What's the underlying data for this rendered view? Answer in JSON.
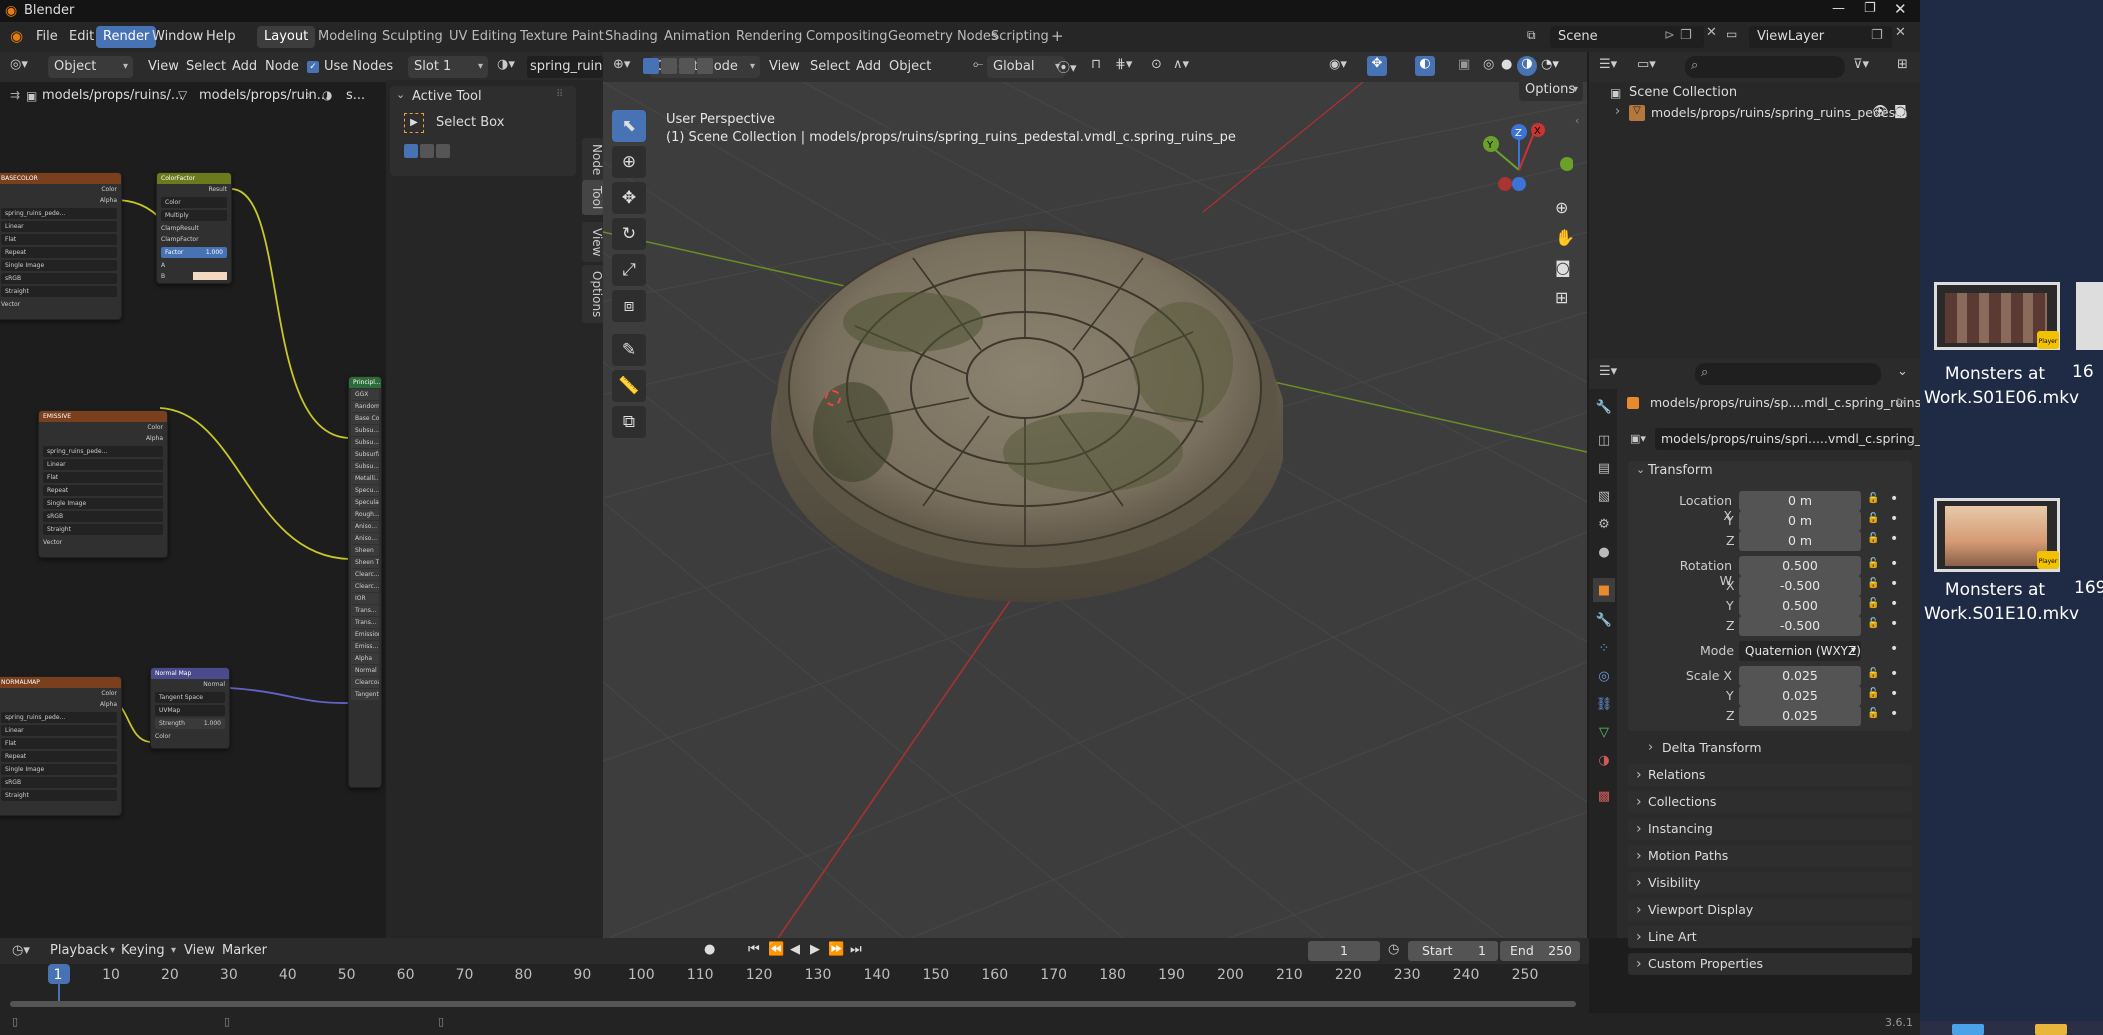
{
  "app": {
    "title": "Blender",
    "version": "3.6.1"
  },
  "menu": [
    "File",
    "Edit",
    "Render",
    "Window",
    "Help"
  ],
  "active_menu": "Render",
  "workspaces": [
    "Layout",
    "Modeling",
    "Sculpting",
    "UV Editing",
    "Texture Paint",
    "Shading",
    "Animation",
    "Rendering",
    "Compositing",
    "Geometry Nodes",
    "Scripting"
  ],
  "active_workspace": "Layout",
  "scene": {
    "name": "Scene",
    "view_layer": "ViewLayer"
  },
  "node_editor": {
    "object_mode": "Object",
    "menus": [
      "View",
      "Select",
      "Add",
      "Node"
    ],
    "use_nodes": "Use Nodes",
    "slot": "Slot 1",
    "material": "spring_ruins_p",
    "breadcrumb": [
      "models/props/ruins/...",
      "models/props/ruin...",
      "s..."
    ],
    "nodes": {
      "basecolor": {
        "title": "BASECOLOR",
        "img": "spring_ruins_pede...",
        "rows": [
          "Linear",
          "Flat",
          "Repeat",
          "Single Image",
          "sRGB",
          "Straight"
        ],
        "outputs": [
          "Color",
          "Alpha"
        ],
        "vector": "Vector"
      },
      "colorfactor": {
        "title": "ColorFactor",
        "out": "Result",
        "rows": [
          "Color",
          "Multiply",
          "ClampResult",
          "ClampFactor"
        ],
        "factor": "Factor",
        "factor_value": "1.000",
        "a": "A",
        "b": "B"
      },
      "emissive": {
        "title": "EMISSIVE",
        "img": "spring_ruins_pede...",
        "rows": [
          "Linear",
          "Flat",
          "Repeat",
          "Single Image",
          "sRGB",
          "Straight"
        ],
        "outputs": [
          "Color",
          "Alpha"
        ],
        "vector": "Vector"
      },
      "normalmap_tex": {
        "title": "NORMALMAP",
        "img": "spring_ruins_pede...",
        "rows": [
          "Linear",
          "Flat",
          "Repeat",
          "Single Image",
          "sRGB",
          "Straight"
        ],
        "outputs": [
          "Color",
          "Alpha"
        ]
      },
      "normalmap": {
        "title": "Normal Map",
        "out": "Normal",
        "space": "Tangent Space",
        "uv": "UVMap",
        "strength": "Strength",
        "strength_value": "1.000",
        "color": "Color"
      },
      "principled": {
        "title": "Principl...",
        "rows": [
          "GGX",
          "Random...",
          "Base Color",
          "Subsu...",
          "Subsu...",
          "Subsurfa...",
          "Subsu...",
          "Metalli...",
          "Specu...",
          "Specula...",
          "Rough...",
          "Aniso...",
          "Aniso...",
          "Sheen",
          "Sheen T...",
          "Clearc...",
          "Clearc...",
          "IOR",
          "Trans...",
          "Trans...",
          "Emission",
          "Emiss...",
          "Alpha",
          "Normal",
          "Clearcoat N...",
          "Tangent"
        ]
      }
    }
  },
  "sidebar_tool": {
    "header": "Active Tool",
    "tool": "Select Box",
    "tabs": [
      "Node",
      "Tool",
      "View",
      "Options"
    ]
  },
  "viewport": {
    "mode": "Object Mode",
    "menus": [
      "View",
      "Select",
      "Add",
      "Object"
    ],
    "transform_orientation": "Global",
    "options": "Options",
    "perspective": "User Perspective",
    "collection_info": "(1) Scene Collection | models/props/ruins/spring_ruins_pedestal.vmdl_c.spring_ruins_pe",
    "gizmo": {
      "x": "X",
      "y": "Y",
      "z": "Z"
    }
  },
  "outliner": {
    "root": "Scene Collection",
    "item": "models/props/ruins/spring_ruins_pedesta"
  },
  "properties": {
    "object_name": "models/props/ruins/sp....mdl_c.spring_ruins_pe",
    "data_name": "models/props/ruins/spri.....vmdl_c.spring_ruins_pe",
    "transform_label": "Transform",
    "location": {
      "label": "Location X",
      "x": "0 m",
      "y": "0 m",
      "z": "0 m"
    },
    "rotation": {
      "label": "Rotation W",
      "w": "0.500",
      "x": "-0.500",
      "y": "0.500",
      "z": "-0.500"
    },
    "mode_label": "Mode",
    "mode": "Quaternion (WXYZ)",
    "scale": {
      "label": "Scale X",
      "x": "0.025",
      "y": "0.025",
      "z": "0.025"
    },
    "axis_labels": {
      "x": "X",
      "y": "Y",
      "z": "Z"
    },
    "delta": "Delta Transform",
    "panels": [
      "Relations",
      "Collections",
      "Instancing",
      "Motion Paths",
      "Visibility",
      "Viewport Display",
      "Line Art",
      "Custom Properties"
    ]
  },
  "timeline": {
    "menus": [
      "Playback",
      "Keying",
      "View",
      "Marker"
    ],
    "current_frame": "1",
    "start_label": "Start",
    "start": "1",
    "end_label": "End",
    "end": "250",
    "ticks": [
      "1",
      "10",
      "20",
      "30",
      "40",
      "50",
      "60",
      "70",
      "80",
      "90",
      "100",
      "110",
      "120",
      "130",
      "140",
      "150",
      "160",
      "170",
      "180",
      "190",
      "200",
      "210",
      "220",
      "230",
      "240",
      "250"
    ]
  },
  "desktop": {
    "files": [
      {
        "name": "Monsters at Work.S01E06.mkv"
      },
      {
        "name": "Monsters at Work.S01E10.mkv"
      }
    ],
    "partial_labels": [
      "16",
      "169"
    ],
    "badge": "Player"
  },
  "colors": {
    "accent": "#4772b3",
    "node_basecolor": "#7a3f1d",
    "node_colorfactor": "#6b7a1c",
    "node_normalmap": "#4a4a8c",
    "node_principled": "#2d6b3a"
  }
}
